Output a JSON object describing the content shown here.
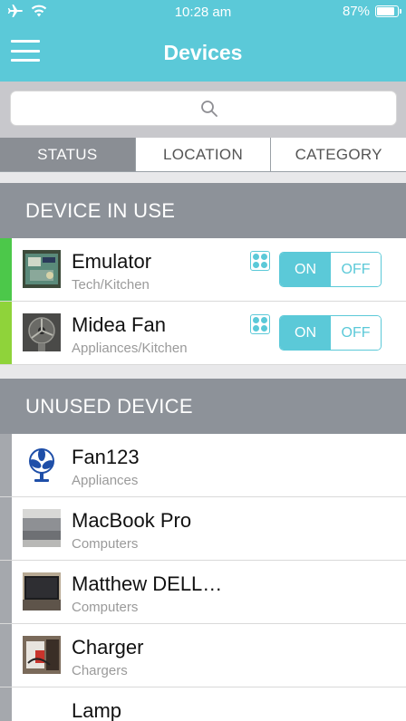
{
  "status_bar": {
    "time": "10:28 am",
    "battery": "87%",
    "battery_level": 0.87
  },
  "nav": {
    "title": "Devices"
  },
  "search": {
    "placeholder": ""
  },
  "tabs": [
    {
      "label": "STATUS",
      "active": true
    },
    {
      "label": "LOCATION",
      "active": false
    },
    {
      "label": "CATEGORY",
      "active": false
    }
  ],
  "sections": {
    "in_use": {
      "title": "DEVICE IN USE"
    },
    "unused": {
      "title": "UNUSED DEVICE"
    }
  },
  "devices_in_use": [
    {
      "name": "Emulator",
      "category": "Tech/Kitchen",
      "on_label": "ON",
      "off_label": "OFF",
      "bar_color": "#4cc84a"
    },
    {
      "name": "Midea Fan",
      "category": "Appliances/Kitchen",
      "on_label": "ON",
      "off_label": "OFF",
      "bar_color": "#8fd33a"
    }
  ],
  "unused_devices": [
    {
      "name": "Fan123",
      "category": "Appliances"
    },
    {
      "name": "MacBook Pro",
      "category": "Computers"
    },
    {
      "name": "Matthew DELL…",
      "category": "Computers"
    },
    {
      "name": "Charger",
      "category": "Chargers"
    },
    {
      "name": "Lamp",
      "category": ""
    }
  ],
  "colors": {
    "accent": "#5bc9d8",
    "section_bg": "#8d9299",
    "unused_bar": "#a5a8ad"
  },
  "icons": {
    "menu": "hamburger-icon",
    "search": "search-icon",
    "airplane": "airplane-icon",
    "wifi": "wifi-icon",
    "grid": "grid-icon"
  }
}
